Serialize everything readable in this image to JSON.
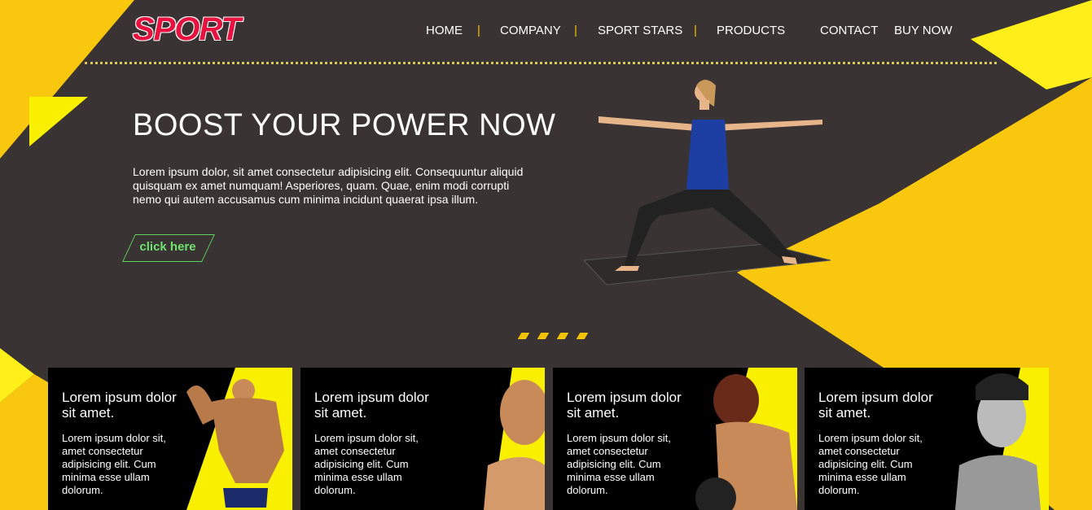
{
  "brand": {
    "logo_text": "SPORT",
    "accent": "#f2c400",
    "logo_color": "#e8123f",
    "background": "#3a3333"
  },
  "nav": {
    "items": [
      "HOME",
      "COMPANY",
      "SPORT STARS",
      "PRODUCTS",
      "CONTACT",
      "BUY NOW"
    ],
    "separator": "|"
  },
  "hero": {
    "title": "BOOST YOUR POWER NOW",
    "text": "Lorem ipsum dolor, sit amet consectetur adipisicing elit. Consequuntur aliquid quisquam ex amet numquam! Asperiores, quam. Quae, enim modi corrupti nemo qui autem accusamus cum minima incidunt quaerat ipsa illum.",
    "cta_label": "click here",
    "cta_color": "#6ee36e"
  },
  "cards": [
    {
      "title": "Lorem ipsum dolor sit amet.",
      "text": "Lorem ipsum dolor sit, amet consectetur adipisicing elit. Cum minima esse ullam dolorum."
    },
    {
      "title": "Lorem ipsum dolor sit amet.",
      "text": "Lorem ipsum dolor sit, amet consectetur adipisicing elit. Cum minima esse ullam dolorum."
    },
    {
      "title": "Lorem ipsum dolor sit amet.",
      "text": "Lorem ipsum dolor sit, amet consectetur adipisicing elit. Cum minima esse ullam dolorum."
    },
    {
      "title": "Lorem ipsum dolor sit amet.",
      "text": "Lorem ipsum dolor sit, amet consectetur adipisicing elit. Cum minima esse ullam dolorum."
    }
  ]
}
